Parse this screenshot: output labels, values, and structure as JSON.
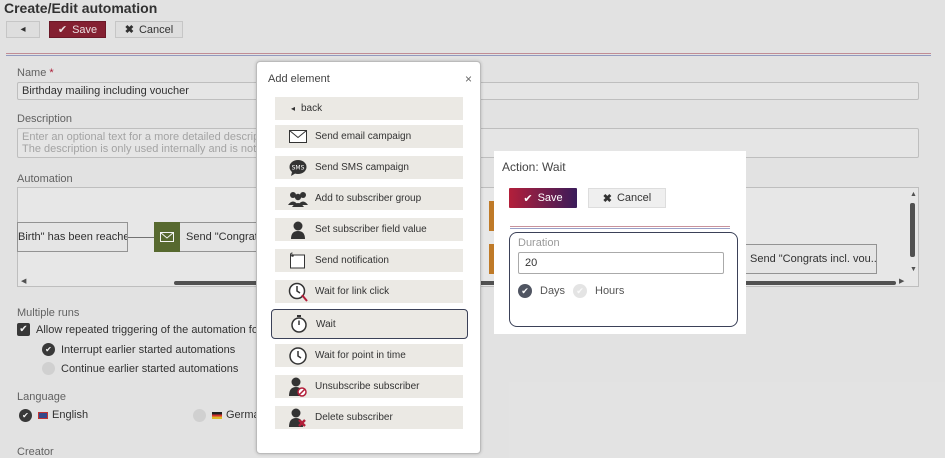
{
  "page": {
    "title": "Create/Edit automation",
    "toolbar": {
      "back_icon": "◂",
      "save_label": "Save",
      "cancel_label": "Cancel"
    },
    "name": {
      "label": "Name",
      "required_mark": "*",
      "value": "Birthday mailing including voucher"
    },
    "description": {
      "label": "Description",
      "placeholder_line1": "Enter an optional text for a more detailed description",
      "placeholder_line2": "The description is only used internally and is not visi"
    },
    "automation": {
      "label": "Automation",
      "nodes": [
        {
          "text": "Birth\" has been reached"
        },
        {
          "text": "Send \"Congrats"
        },
        {
          "text": "Send \"Congrats incl. vou...\""
        }
      ]
    },
    "multiple_runs": {
      "label": "Multiple runs",
      "allow_label": "Allow repeated triggering of the automation for ea",
      "options": [
        {
          "label": "Interrupt earlier started automations",
          "selected": true
        },
        {
          "label": "Continue earlier started automations",
          "selected": false
        }
      ]
    },
    "language": {
      "label": "Language",
      "options": [
        {
          "label": "English",
          "selected": true
        },
        {
          "label": "Germa",
          "selected": false
        }
      ]
    },
    "creator": {
      "label": "Creator"
    }
  },
  "add_element_dialog": {
    "title": "Add element",
    "close_icon": "×",
    "items": [
      {
        "label": "back",
        "icon": "back-arrow-icon"
      },
      {
        "label": "Send email campaign",
        "icon": "envelope-icon"
      },
      {
        "label": "Send SMS campaign",
        "icon": "sms-icon"
      },
      {
        "label": "Add to subscriber group",
        "icon": "group-icon"
      },
      {
        "label": "Set subscriber field value",
        "icon": "person-icon"
      },
      {
        "label": "Send notification",
        "icon": "notification-icon"
      },
      {
        "label": "Wait for link click",
        "icon": "clock-link-icon"
      },
      {
        "label": "Wait",
        "icon": "stopwatch-icon",
        "selected": true
      },
      {
        "label": "Wait for point in time",
        "icon": "clock-icon"
      },
      {
        "label": "Unsubscribe subscriber",
        "icon": "unsubscribe-icon"
      },
      {
        "label": "Delete subscriber",
        "icon": "delete-subscriber-icon"
      }
    ]
  },
  "action_panel": {
    "title": "Action: Wait",
    "save_label": "Save",
    "cancel_label": "Cancel",
    "duration_label": "Duration",
    "duration_value": "20",
    "units": [
      {
        "label": "Days",
        "selected": true
      },
      {
        "label": "Hours",
        "selected": false
      }
    ]
  },
  "colors": {
    "save_button": "#8a2234",
    "accent_dark": "#3b4158",
    "node_icon_green": "#5b6e31",
    "connector_orange": "#c77f2a"
  }
}
